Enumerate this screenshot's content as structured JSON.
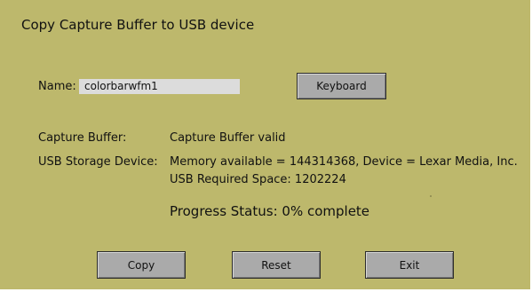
{
  "dialog": {
    "title": "Copy Capture Buffer to USB device"
  },
  "name_field": {
    "label": "Name:",
    "value": "colorbarwfm1"
  },
  "buttons": {
    "keyboard": "Keyboard",
    "copy": "Copy",
    "reset": "Reset",
    "exit": "Exit"
  },
  "capture_buffer": {
    "label": "Capture Buffer:",
    "status": "Capture Buffer valid"
  },
  "usb_device": {
    "label": "USB Storage Device:",
    "info": "Memory available = 144314368, Device = Lexar Media, Inc.",
    "required_space": "USB Required Space: 1202224"
  },
  "progress": {
    "text": "Progress Status: 0% complete",
    "percent": 0
  },
  "colors": {
    "background": "#bdb86c",
    "button": "#aaaaaa",
    "field": "#dcdcdc"
  }
}
